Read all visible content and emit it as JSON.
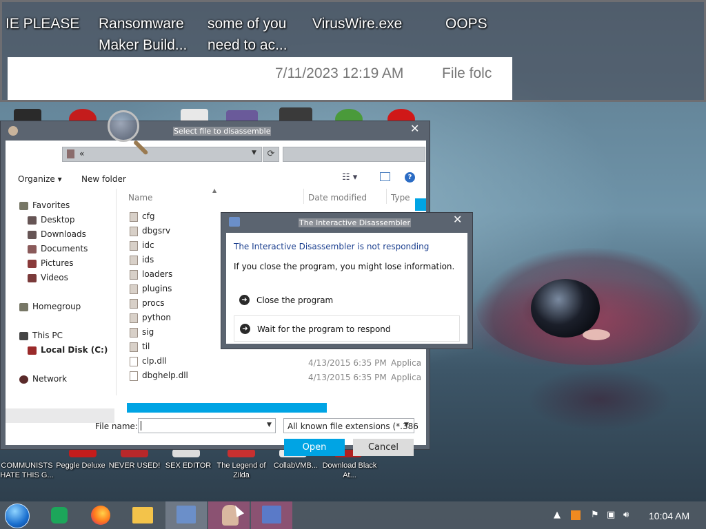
{
  "background_window": {
    "tiles": [
      {
        "line1": "IE PLEASE",
        "line2": ""
      },
      {
        "line1": "Ransomware",
        "line2": "Maker Build..."
      },
      {
        "line1": "some of you",
        "line2": "need to ac..."
      },
      {
        "line1": "VirusWire.exe",
        "line2": ""
      },
      {
        "line1": "OOPS",
        "line2": ""
      }
    ],
    "date_modified": "7/11/2023 12:19 AM",
    "type": "File folc"
  },
  "desktop_icons": [
    {
      "label": "COMMUNISTS HATE THIS G...",
      "icon": "flag-icon"
    },
    {
      "label": "Peggle Deluxe",
      "icon": "peggle-icon"
    },
    {
      "label": "NEVER USED!",
      "icon": "app-icon"
    },
    {
      "label": "SEX EDITOR",
      "icon": "app-icon"
    },
    {
      "label": "The Legend of Zilda",
      "icon": "game-icon"
    },
    {
      "label": "CollabVMB...",
      "icon": "app-icon"
    },
    {
      "label": "Download Black At...",
      "icon": "download-icon"
    }
  ],
  "file_dialog": {
    "title": "Select file to disassemble",
    "address": "«",
    "toolbar": {
      "organize": "Organize ▾",
      "new_folder": "New folder"
    },
    "nav": {
      "favorites": "Favorites",
      "desktop": "Desktop",
      "downloads": "Downloads",
      "documents": "Documents",
      "pictures": "Pictures",
      "videos": "Videos",
      "homegroup": "Homegroup",
      "this_pc": "This PC",
      "local_disk": "Local Disk (C:)",
      "network": "Network"
    },
    "columns": {
      "name": "Name",
      "date": "Date modified",
      "type": "Type"
    },
    "files": [
      {
        "name": "cfg",
        "date": "",
        "type": ""
      },
      {
        "name": "dbgsrv",
        "date": "",
        "type": ""
      },
      {
        "name": "idc",
        "date": "",
        "type": ""
      },
      {
        "name": "ids",
        "date": "",
        "type": ""
      },
      {
        "name": "loaders",
        "date": "",
        "type": ""
      },
      {
        "name": "plugins",
        "date": "",
        "type": ""
      },
      {
        "name": "procs",
        "date": "",
        "type": ""
      },
      {
        "name": "python",
        "date": "",
        "type": ""
      },
      {
        "name": "sig",
        "date": "",
        "type": ""
      },
      {
        "name": "til",
        "date": "",
        "type": ""
      },
      {
        "name": "clp.dll",
        "date": "4/13/2015 6:35 PM",
        "type": "Applica"
      },
      {
        "name": "dbghelp.dll",
        "date": "4/13/2015 6:35 PM",
        "type": "Applica"
      }
    ],
    "file_name_label": "File name:",
    "file_name_value": "",
    "file_type": "All known file extensions (*.386",
    "open": "Open",
    "cancel": "Cancel"
  },
  "not_responding": {
    "title": "The Interactive Disassembler",
    "heading": "The Interactive Disassembler is not responding",
    "message": "If you close the program, you might lose information.",
    "close_option": "Close the program",
    "wait_option": "Wait for the program to respond"
  },
  "taskbar": {
    "clock": "10:04 AM",
    "items": [
      "start-orb",
      "notes-icon",
      "firefox-icon",
      "file-explorer-icon",
      "disassembler-icon",
      "portrait-icon",
      "ida-icon"
    ]
  },
  "colors": {
    "accent": "#00a4e4",
    "heading": "#1b3f8f"
  }
}
